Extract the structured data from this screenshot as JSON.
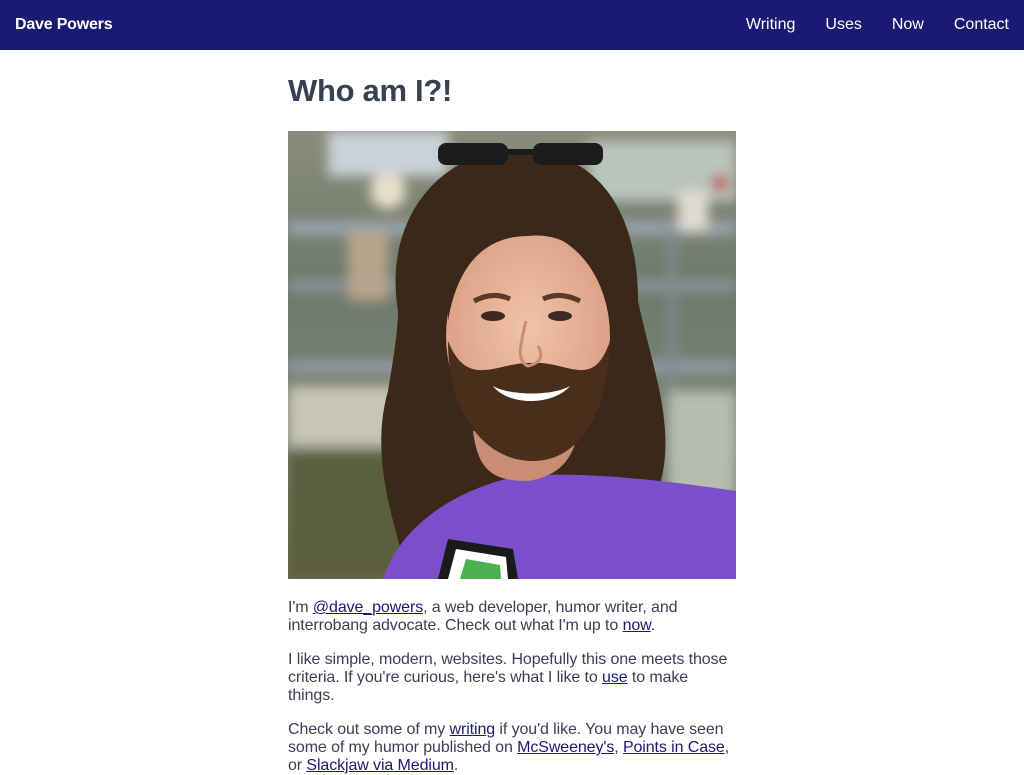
{
  "nav": {
    "brand": "Dave Powers",
    "links": [
      "Writing",
      "Uses",
      "Now",
      "Contact"
    ]
  },
  "page": {
    "title": "Who am I?!"
  },
  "paragraphs": {
    "p1": {
      "t1": "I'm ",
      "link1": "@dave_powers",
      "t2": ", a web developer, humor writer, and interrobang advocate. Check out what I'm up to ",
      "link2": "now",
      "t3": "."
    },
    "p2": {
      "t1": "I like simple, modern, websites. Hopefully this one meets those criteria. If you're curious, here's what I like to ",
      "link1": "use",
      "t2": " to make things."
    },
    "p3": {
      "t1": "Check out some of my ",
      "link1": "writing",
      "t2": " if you'd like. You may have seen some of my humor published on ",
      "link2": "McSweeney's",
      "t3": ", ",
      "link3": "Points in Case",
      "t4": ", or ",
      "link4": "Slackjaw via Medium",
      "t5": "."
    }
  },
  "colors": {
    "navbar": "#1a1a73",
    "heading": "#374151",
    "link": "#1a1a73",
    "shirt": "#7a4fc9"
  }
}
